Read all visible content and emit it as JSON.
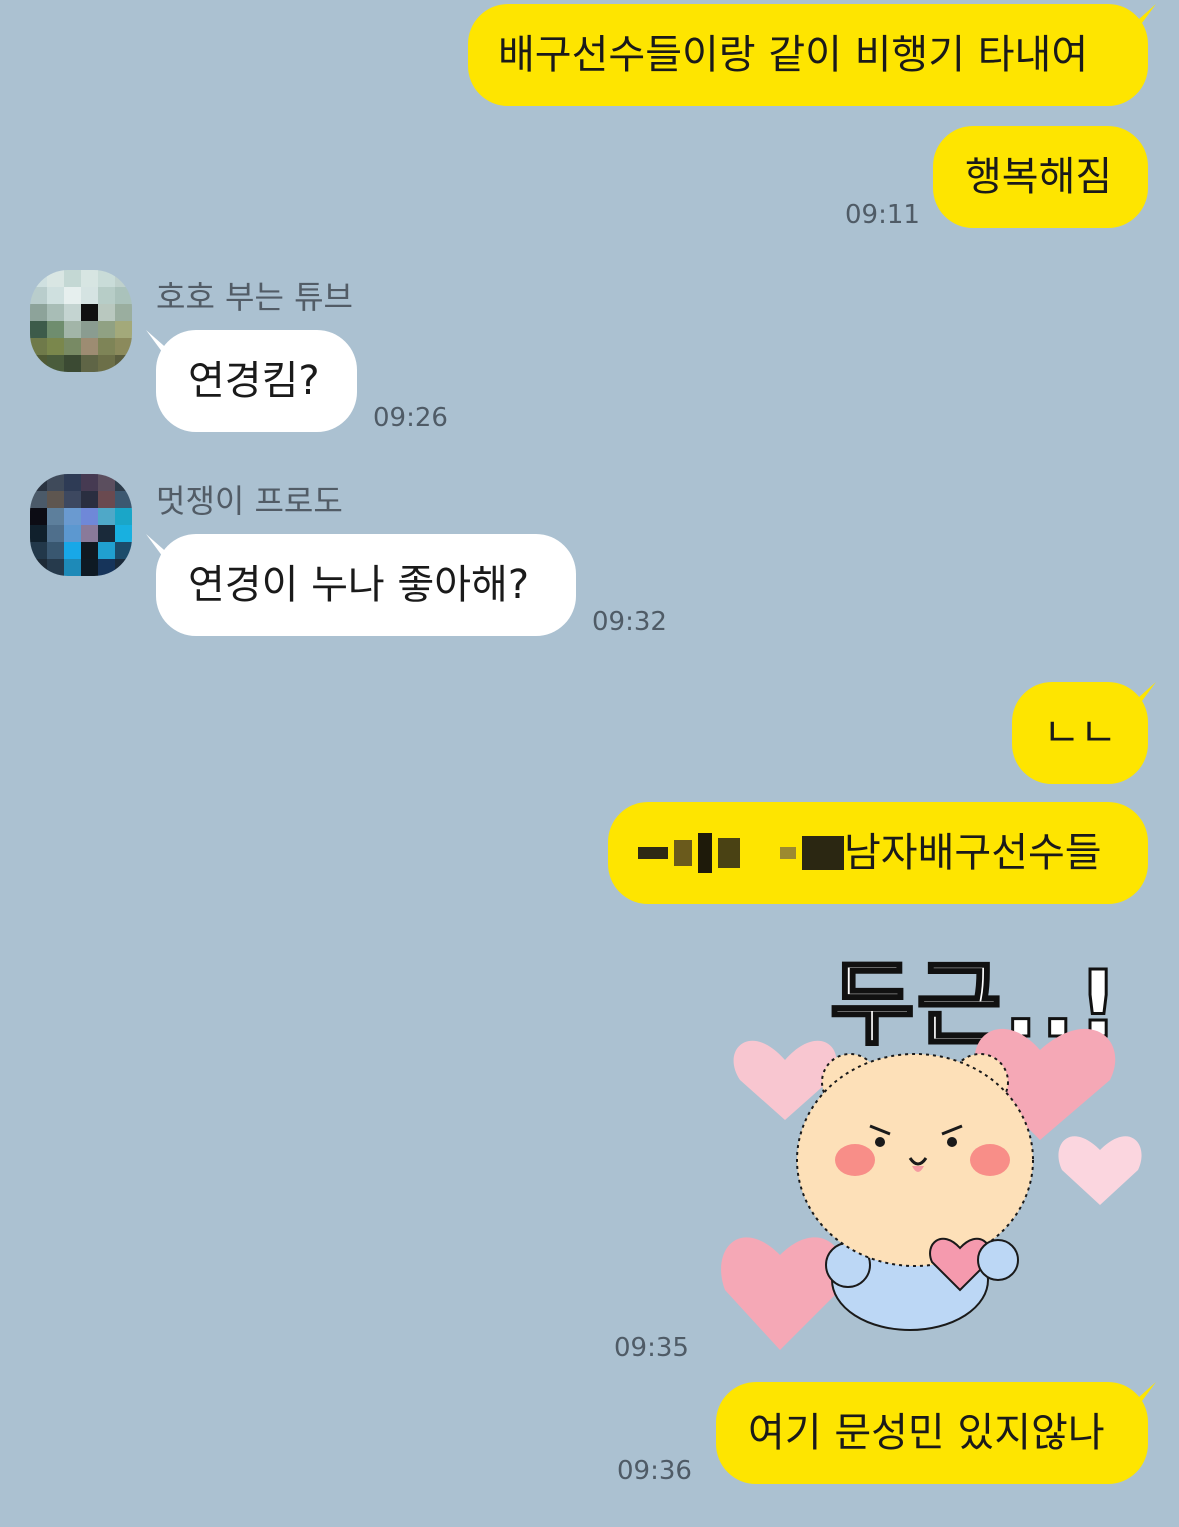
{
  "chat": {
    "messages": [
      {
        "sender": "me",
        "text": "배구선수들이랑 같이 비행기 타내여"
      },
      {
        "sender": "me",
        "text": "행복해짐",
        "time": "09:11"
      },
      {
        "sender_name": "호호 부는 튜브",
        "text": "연경킴?",
        "time": "09:26"
      },
      {
        "sender_name": "멋쟁이 프로도",
        "text": "연경이 누나 좋아해?",
        "time": "09:32"
      },
      {
        "sender": "me",
        "text": "ㄴㄴ"
      },
      {
        "sender": "me",
        "text": "남자배구선수들"
      },
      {
        "sender": "me",
        "sticker_text": "두근..!",
        "time": "09:35"
      },
      {
        "sender": "me",
        "text": "여기 문성민 있지않나",
        "time": "09:36"
      }
    ]
  },
  "colors": {
    "background": "#abc1d1",
    "my_bubble": "#fee500",
    "their_bubble": "#ffffff"
  },
  "icons": {
    "avatar_tube": "pixelated-avatar",
    "avatar_frodo": "pixelated-avatar",
    "sticker": "bear-with-hearts-sticker"
  }
}
